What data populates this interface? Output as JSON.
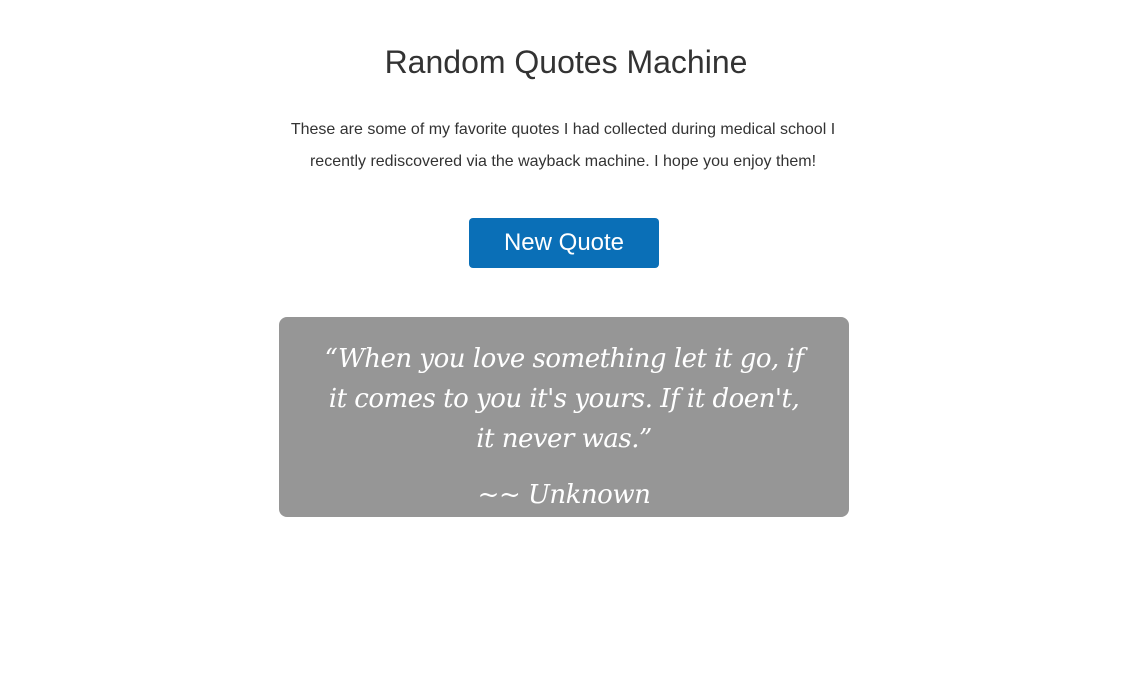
{
  "header": {
    "title": "Random Quotes Machine"
  },
  "intro": {
    "text": "These are some of my favorite quotes I had collected during medical school I recently rediscovered via the wayback machine. I hope you enjoy them!"
  },
  "actions": {
    "new_quote_label": "New Quote",
    "button_color": "#0a6fb7"
  },
  "quote": {
    "text": "“When you love something let it go, if it comes to you it's yours. If it doen't, it never was.”",
    "author": "~~ Unknown",
    "box_color": "#969696"
  }
}
